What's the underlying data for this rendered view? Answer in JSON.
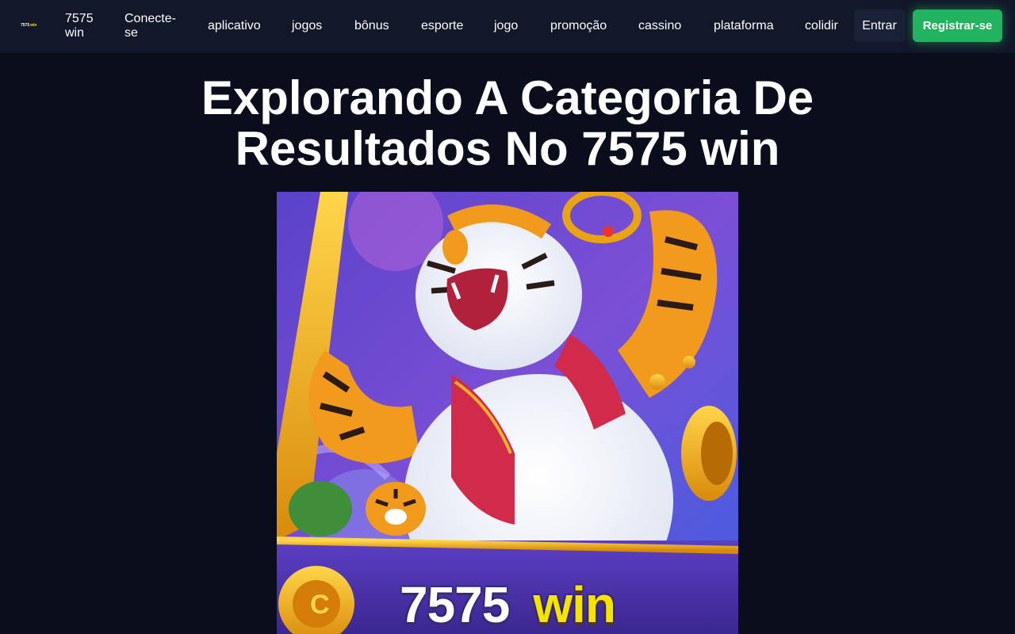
{
  "nav": {
    "logo_text_num": "7575",
    "logo_text_win": "win",
    "items": [
      {
        "label": "7575 win"
      },
      {
        "label": "Conecte-se"
      },
      {
        "label": "aplicativo"
      },
      {
        "label": "jogos"
      },
      {
        "label": "bônus"
      },
      {
        "label": "esporte"
      },
      {
        "label": "jogo"
      },
      {
        "label": "promoção"
      },
      {
        "label": "cassino"
      },
      {
        "label": "plataforma"
      },
      {
        "label": "colidir"
      }
    ],
    "login_label": "Entrar",
    "register_label": "Registrar-se"
  },
  "main": {
    "headline": "Explorando A Categoria De Resultados No 7575 win"
  },
  "hero": {
    "brand_num": "7575",
    "brand_win": "win"
  },
  "colors": {
    "background": "#0a0e1c",
    "navbar": "#121729",
    "register_button": "#22b35e",
    "brand_yellow": "#f5e400"
  }
}
